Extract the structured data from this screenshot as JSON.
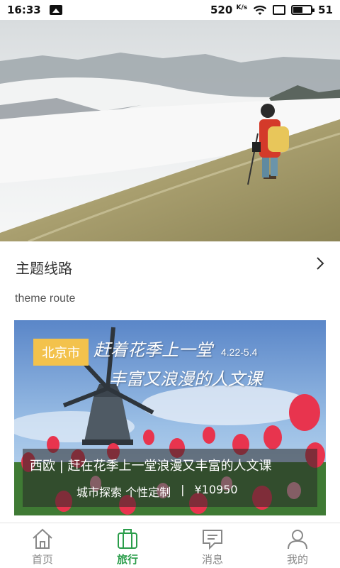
{
  "status_bar": {
    "time": "16:33",
    "speed_value": "520",
    "speed_unit": "K/s",
    "battery": "51"
  },
  "section": {
    "title": "主题线路",
    "subtitle": "theme route"
  },
  "route_card": {
    "city": "北京市",
    "headline_line1": "赶着花季上一堂",
    "headline_date": "4.22-5.4",
    "headline_line2": "丰富又浪漫的人文课",
    "title": "西欧 | 赶在花季上一堂浪漫又丰富的人文课",
    "tags": "城市探索  个性定制",
    "separator": "|",
    "price": "¥10950"
  },
  "tabs": [
    {
      "label": "首页",
      "icon": "home-icon",
      "active": false
    },
    {
      "label": "旅行",
      "icon": "luggage-icon",
      "active": true
    },
    {
      "label": "消息",
      "icon": "message-icon",
      "active": false
    },
    {
      "label": "我的",
      "icon": "person-icon",
      "active": false
    }
  ],
  "colors": {
    "accent": "#2a9d4a",
    "city_tag": "#f3c24c",
    "inactive_tab": "#888888"
  }
}
